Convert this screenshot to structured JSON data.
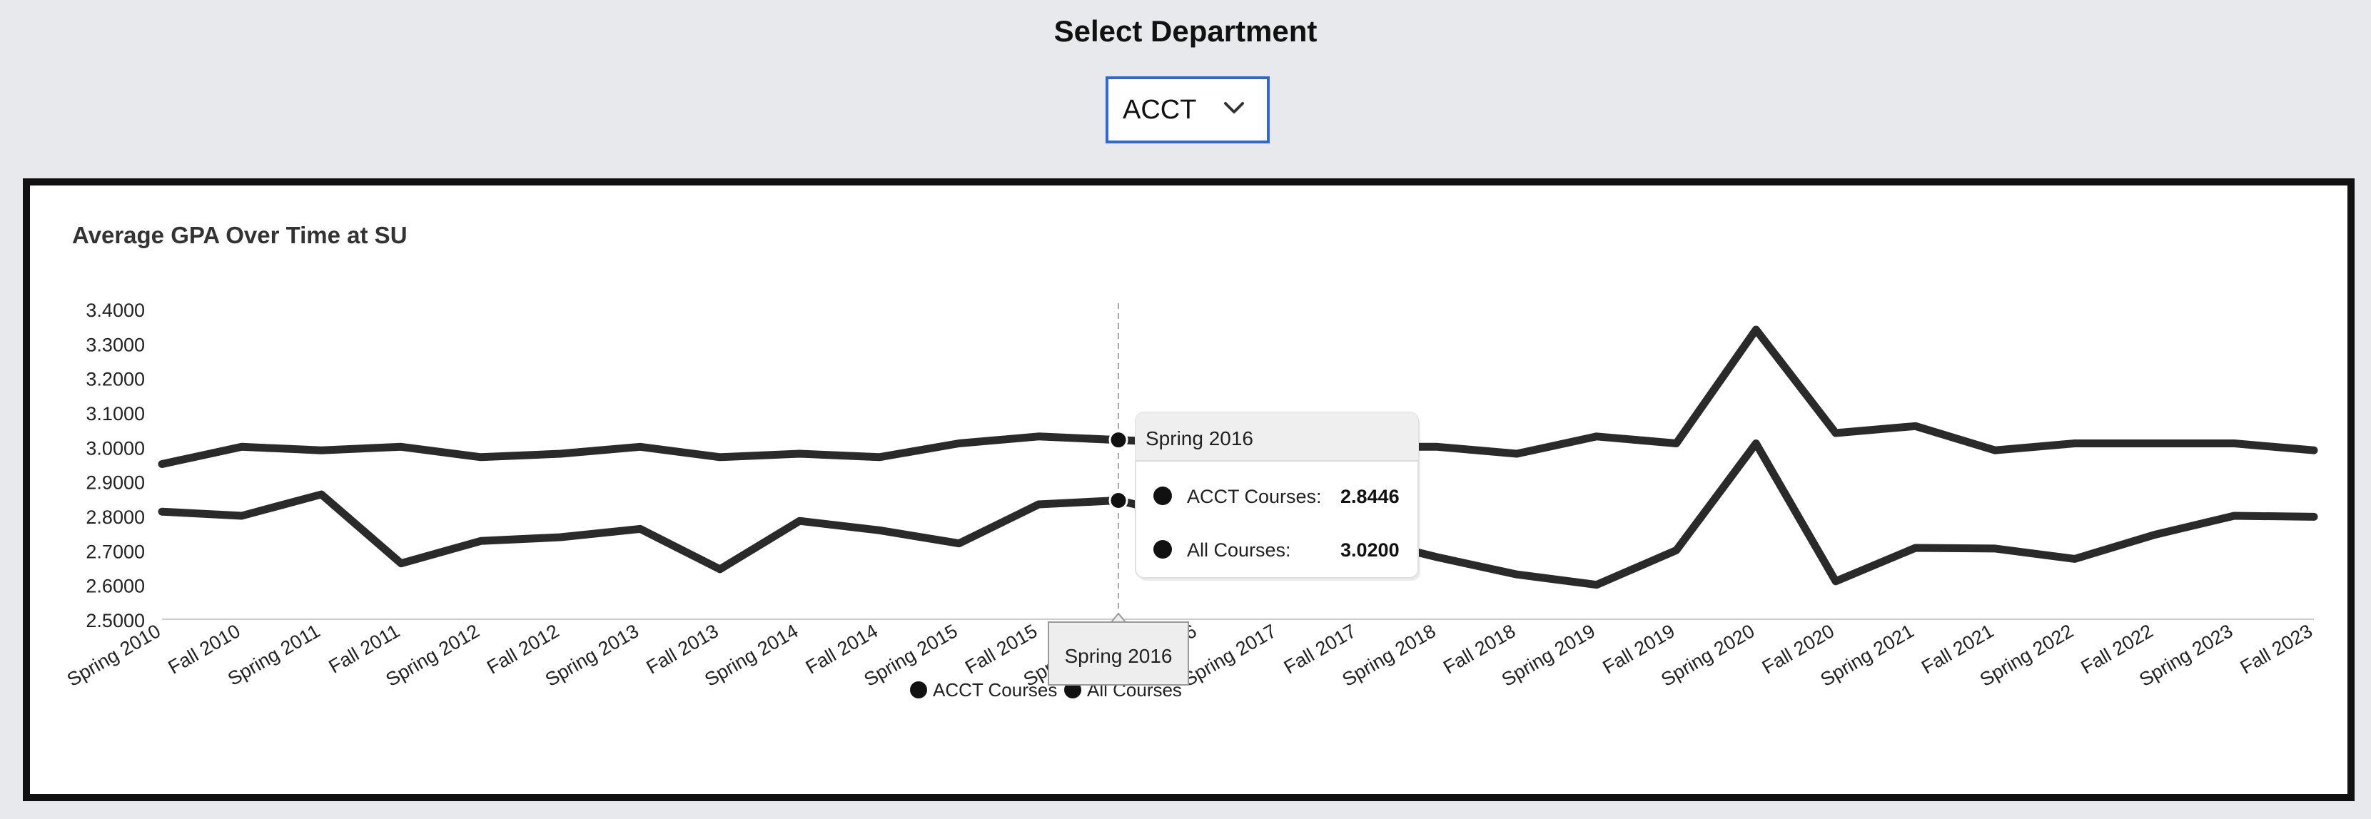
{
  "header": {
    "title": "Select Department"
  },
  "department_select": {
    "selected": "ACCT",
    "icon": "chevron-down-icon"
  },
  "colors": {
    "line": "#2a2a2a",
    "select_border": "#3366d6",
    "background": "#e8e9ed",
    "card_border": "#111111"
  },
  "chart_data": {
    "type": "line",
    "title": "Average GPA Over Time at SU",
    "categories": [
      "Spring 2010",
      "Fall 2010",
      "Spring 2011",
      "Fall 2011",
      "Spring 2012",
      "Fall 2012",
      "Spring 2013",
      "Fall 2013",
      "Spring 2014",
      "Fall 2014",
      "Spring 2015",
      "Fall 2015",
      "Spring 2016",
      "Fall 2016",
      "Spring 2017",
      "Fall 2017",
      "Spring 2018",
      "Fall 2018",
      "Spring 2019",
      "Fall 2019",
      "Spring 2020",
      "Fall 2020",
      "Spring 2021",
      "Fall 2021",
      "Spring 2022",
      "Fall 2022",
      "Spring 2023",
      "Fall 2023"
    ],
    "series": [
      {
        "name": "ACCT Courses",
        "values": [
          2.812,
          2.8,
          2.862,
          2.662,
          2.727,
          2.738,
          2.762,
          2.645,
          2.785,
          2.758,
          2.72,
          2.833,
          2.8446,
          2.79,
          2.74,
          2.737,
          2.68,
          2.63,
          2.6,
          2.7,
          3.01,
          2.61,
          2.707,
          2.705,
          2.675,
          2.745,
          2.8,
          2.797
        ]
      },
      {
        "name": "All Courses",
        "values": [
          2.95,
          3.0,
          2.99,
          3.0,
          2.97,
          2.98,
          3.0,
          2.97,
          2.98,
          2.97,
          3.01,
          3.03,
          3.02,
          3.01,
          3.0,
          3.0,
          3.0,
          2.98,
          3.03,
          3.01,
          3.34,
          3.04,
          3.06,
          2.99,
          3.01,
          3.01,
          3.01,
          2.99
        ]
      }
    ],
    "y_ticks": [
      "3.4000",
      "3.3000",
      "3.2000",
      "3.1000",
      "3.0000",
      "2.9000",
      "2.8000",
      "2.7000",
      "2.6000",
      "2.5000"
    ],
    "ylim": [
      2.5,
      3.4
    ],
    "legend_position": "bottom",
    "tooltip": {
      "category": "Spring 2016",
      "rows": [
        {
          "label": "ACCT Courses:",
          "value": "2.8446"
        },
        {
          "label": "All Courses:",
          "value": "3.0200"
        }
      ],
      "axis_label": "Spring 2016"
    }
  }
}
